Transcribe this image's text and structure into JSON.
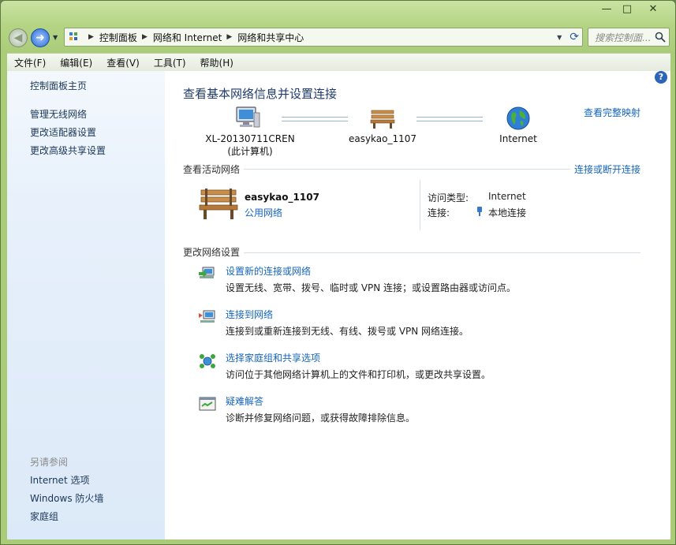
{
  "window": {
    "caption_buttons": {
      "minimize": "—",
      "maximize": "□",
      "close": "✕"
    }
  },
  "nav": {
    "breadcrumbs": [
      "控制面板",
      "网络和 Internet",
      "网络和共享中心"
    ],
    "search_placeholder": "搜索控制面..."
  },
  "menu": [
    "文件(F)",
    "编辑(E)",
    "查看(V)",
    "工具(T)",
    "帮助(H)"
  ],
  "sidebar": {
    "links": [
      "控制面板主页",
      "管理无线网络",
      "更改适配器设置",
      "更改高级共享设置"
    ],
    "see_also_heading": "另请参阅",
    "see_also": [
      "Internet 选项",
      "Windows 防火墙",
      "家庭组"
    ]
  },
  "main": {
    "title": "查看基本网络信息并设置连接",
    "map_link": "查看完整映射",
    "nodes": {
      "computer_line1": "XL-20130711CREN",
      "computer_line2": "(此计算机)",
      "network": "easykao_1107",
      "internet": "Internet"
    },
    "active_heading": "查看活动网络",
    "connect_link": "连接或断开连接",
    "active_network": {
      "name": "easykao_1107",
      "type": "公用网络",
      "access_label": "访问类型:",
      "access_value": "Internet",
      "connection_label": "连接:",
      "connection_value": "本地连接"
    },
    "change_heading": "更改网络设置",
    "tasks": [
      {
        "title": "设置新的连接或网络",
        "desc": "设置无线、宽带、拨号、临时或 VPN 连接；或设置路由器或访问点。"
      },
      {
        "title": "连接到网络",
        "desc": "连接到或重新连接到无线、有线、拨号或 VPN 网络连接。"
      },
      {
        "title": "选择家庭组和共享选项",
        "desc": "访问位于其他网络计算机上的文件和打印机，或更改共享设置。"
      },
      {
        "title": "疑难解答",
        "desc": "诊断并修复网络问题，或获得故障排除信息。"
      }
    ]
  },
  "colors": {
    "link": "#1565c0",
    "title": "#1e3a6e",
    "frame": "#b5d585"
  }
}
